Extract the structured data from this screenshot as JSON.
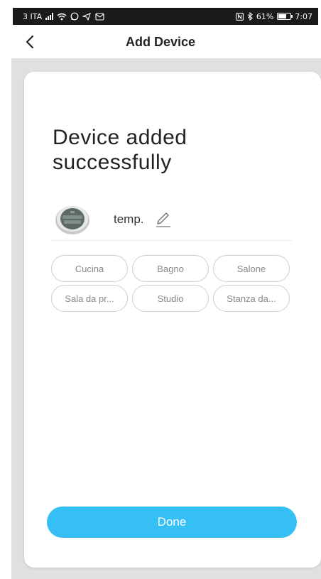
{
  "status_bar": {
    "carrier": "3 ITA",
    "battery_percent": "61%",
    "time": "7:07"
  },
  "header": {
    "back_label": "<",
    "title": "Add Device"
  },
  "card": {
    "success_title": "Device added successfully",
    "device": {
      "name": "temp.",
      "icon": "lcd-thermometer-icon"
    },
    "rooms": [
      "Cucina",
      "Bagno",
      "Salone",
      "Sala da pr...",
      "Studio",
      "Stanza da..."
    ],
    "done_label": "Done"
  },
  "colors": {
    "accent": "#36bff5",
    "background": "#e0e0e0",
    "card": "#ffffff",
    "status_bar": "#1b1b1b"
  }
}
